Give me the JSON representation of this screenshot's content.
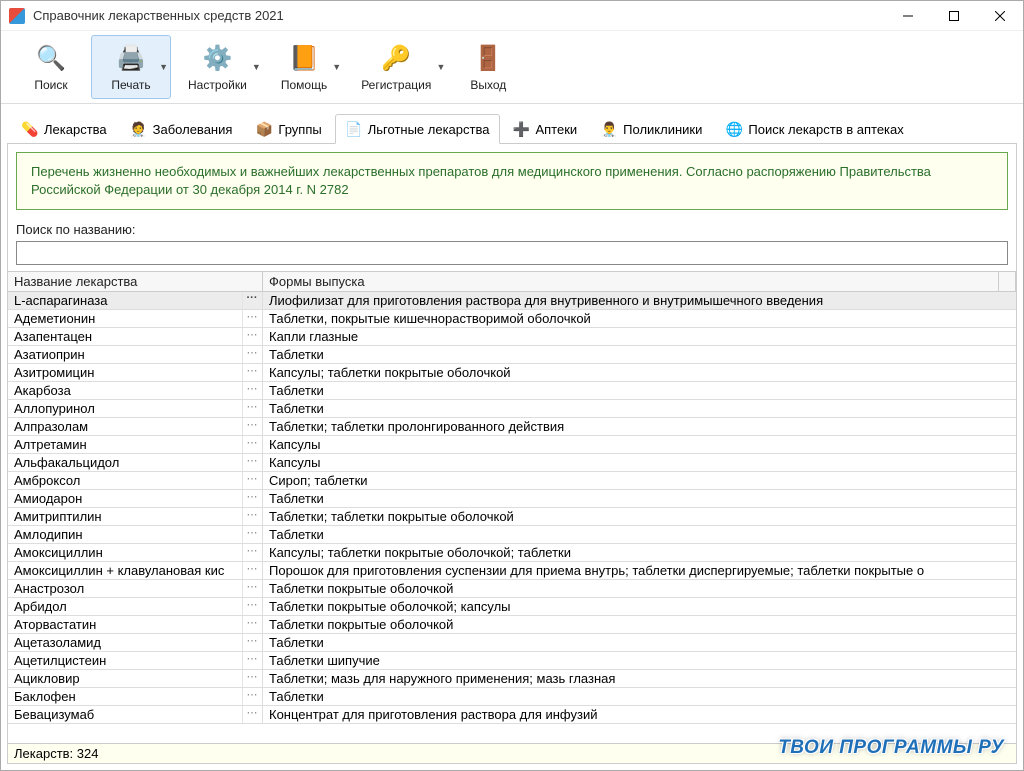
{
  "window": {
    "title": "Справочник лекарственных средств 2021"
  },
  "toolbar": [
    {
      "label": "Поиск",
      "icon": "🔍",
      "dd": false
    },
    {
      "label": "Печать",
      "icon": "🖨️",
      "dd": true,
      "active": true
    },
    {
      "label": "Настройки",
      "icon": "⚙️",
      "dd": true
    },
    {
      "label": "Помощь",
      "icon": "📙",
      "dd": true
    },
    {
      "label": "Регистрация",
      "icon": "🔑",
      "dd": true
    },
    {
      "label": "Выход",
      "icon": "🚪",
      "dd": false
    }
  ],
  "tabs": [
    {
      "label": "Лекарства",
      "icon": "💊"
    },
    {
      "label": "Заболевания",
      "icon": "🧑‍⚕️"
    },
    {
      "label": "Группы",
      "icon": "📦"
    },
    {
      "label": "Льготные лекарства",
      "icon": "📄",
      "active": true
    },
    {
      "label": "Аптеки",
      "icon": "➕"
    },
    {
      "label": "Поликлиники",
      "icon": "👨‍⚕️"
    },
    {
      "label": "Поиск лекарств в аптеках",
      "icon": "🌐"
    }
  ],
  "banner": "Перечень жизненно необходимых и важнейших лекарственных препаратов для медицинского применения. Согласно распоряжению Правительства Российской Федерации от 30 декабря 2014 г. N 2782",
  "search": {
    "label": "Поиск по названию:",
    "value": ""
  },
  "columns": {
    "name": "Название лекарства",
    "form": "Формы выпуска"
  },
  "rows": [
    {
      "name": "L-аспарагиназа",
      "form": "Лиофилизат для приготовления раствора для внутривенного и внутримышечного введения",
      "sel": true
    },
    {
      "name": "Адеметионин",
      "form": "Таблетки, покрытые кишечнорастворимой оболочкой"
    },
    {
      "name": "Азапентацен",
      "form": "Капли глазные"
    },
    {
      "name": "Азатиоприн",
      "form": "Таблетки"
    },
    {
      "name": "Азитромицин",
      "form": "Капсулы; таблетки покрытые оболочкой"
    },
    {
      "name": "Акарбоза",
      "form": "Таблетки"
    },
    {
      "name": "Аллопуринол",
      "form": "Таблетки"
    },
    {
      "name": "Алпразолам",
      "form": "Таблетки; таблетки пролонгированного действия"
    },
    {
      "name": "Алтретамин",
      "form": "Капсулы"
    },
    {
      "name": "Альфакальцидол",
      "form": "Капсулы"
    },
    {
      "name": "Амброксол",
      "form": "Сироп; таблетки"
    },
    {
      "name": "Амиодарон",
      "form": "Таблетки"
    },
    {
      "name": "Амитриптилин",
      "form": "Таблетки; таблетки покрытые оболочкой"
    },
    {
      "name": "Амлодипин",
      "form": "Таблетки"
    },
    {
      "name": "Амоксициллин",
      "form": "Капсулы; таблетки покрытые оболочкой; таблетки"
    },
    {
      "name": "Амоксициллин + клавулановая кис",
      "form": "Порошок для приготовления суспензии для приема внутрь; таблетки диспергируемые; таблетки покрытые о"
    },
    {
      "name": "Анастрозол",
      "form": "Таблетки покрытые оболочкой"
    },
    {
      "name": "Арбидол",
      "form": "Таблетки покрытые оболочкой; капсулы"
    },
    {
      "name": "Аторвастатин",
      "form": "Таблетки покрытые оболочкой"
    },
    {
      "name": "Ацетазоламид",
      "form": "Таблетки"
    },
    {
      "name": "Ацетилцистеин",
      "form": "Таблетки шипучие"
    },
    {
      "name": "Ацикловир",
      "form": "Таблетки; мазь для наружного применения; мазь глазная"
    },
    {
      "name": "Баклофен",
      "form": "Таблетки"
    },
    {
      "name": "Бевацизумаб",
      "form": "Концентрат для приготовления раствора для инфузий"
    }
  ],
  "status": "Лекарств: 324",
  "watermark": "ТВОИ ПРОГРАММЫ РУ"
}
